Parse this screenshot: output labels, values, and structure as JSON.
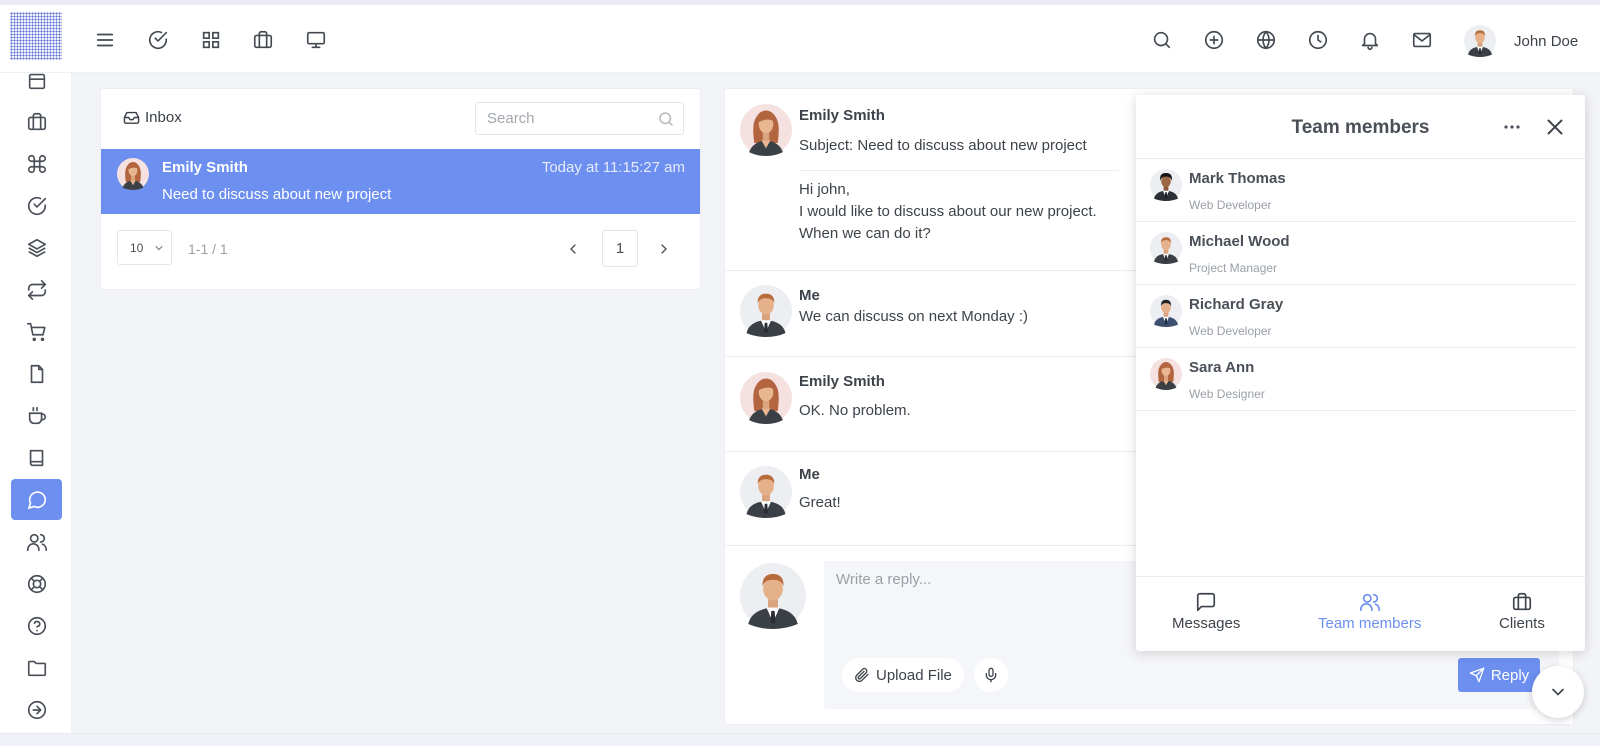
{
  "user": {
    "name": "John Doe"
  },
  "header": {
    "icons": [
      "menu-icon",
      "check-circle-icon",
      "grid-icon",
      "briefcase-icon",
      "monitor-icon",
      "search-icon",
      "plus-circle-icon",
      "globe-icon",
      "clock-icon",
      "bell-icon",
      "mail-icon"
    ]
  },
  "sidebar": {
    "icons": [
      "calendar-icon",
      "briefcase-icon",
      "command-icon",
      "check-circle-icon",
      "layers-icon",
      "repeat-icon",
      "cart-icon",
      "file-icon",
      "coffee-icon",
      "book-icon",
      "chat-icon",
      "users-icon",
      "lifebuoy-icon",
      "help-circle-icon",
      "folder-icon",
      "arrow-right-circle-icon"
    ],
    "active": "chat-icon"
  },
  "inbox": {
    "title": "Inbox",
    "search_placeholder": "Search",
    "mails": [
      {
        "sender": "Emily Smith",
        "time": "Today at 11:15:27 am",
        "subject": "Need to discuss about new project"
      }
    ],
    "per_page": "10",
    "page_info": "1-1 / 1",
    "current_page": "1"
  },
  "chat": {
    "first": {
      "sender": "Emily Smith",
      "subject": "Subject: Need to discuss about new project",
      "body": [
        "Hi john,",
        "I would like to discuss about our new project.",
        "When we can do it?"
      ]
    },
    "replies": [
      {
        "sender": "Me",
        "text": "We can discuss on next Monday :)"
      },
      {
        "sender": "Emily Smith",
        "text": "OK. No problem."
      },
      {
        "sender": "Me",
        "text": "Great!"
      }
    ],
    "reply_placeholder": "Write a reply...",
    "upload_label": "Upload File",
    "reply_label": "Reply"
  },
  "team": {
    "title": "Team members",
    "members": [
      {
        "name": "Mark Thomas",
        "role": "Web Developer"
      },
      {
        "name": "Michael Wood",
        "role": "Project Manager"
      },
      {
        "name": "Richard Gray",
        "role": "Web Developer"
      },
      {
        "name": "Sara Ann",
        "role": "Web Designer"
      }
    ],
    "tabs": [
      {
        "label": "Messages",
        "icon": "message-square-icon"
      },
      {
        "label": "Team members",
        "icon": "users-icon",
        "active": true
      },
      {
        "label": "Clients",
        "icon": "briefcase-icon"
      }
    ]
  },
  "colors": {
    "accent": "#6c8ff0",
    "background": "#f3f4f8",
    "text": "#3d434a"
  }
}
